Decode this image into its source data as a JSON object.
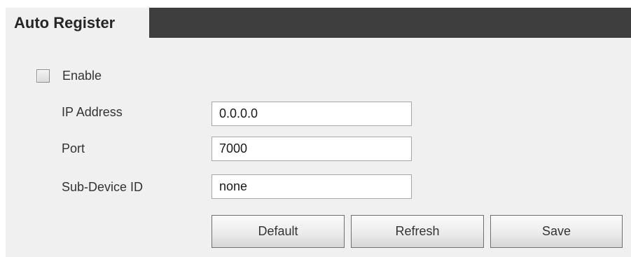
{
  "tab": {
    "title": "Auto Register"
  },
  "enable": {
    "label": "Enable",
    "checked": false
  },
  "fields": {
    "ip_address": {
      "label": "IP Address",
      "value": "0.0.0.0"
    },
    "port": {
      "label": "Port",
      "value": "7000"
    },
    "sub_device_id": {
      "label": "Sub-Device ID",
      "value": "none"
    }
  },
  "buttons": {
    "default": "Default",
    "refresh": "Refresh",
    "save": "Save"
  },
  "colors": {
    "header_bar": "#3e3e3e",
    "panel_background": "#f0f0f0",
    "input_border": "#a8a8a8"
  }
}
